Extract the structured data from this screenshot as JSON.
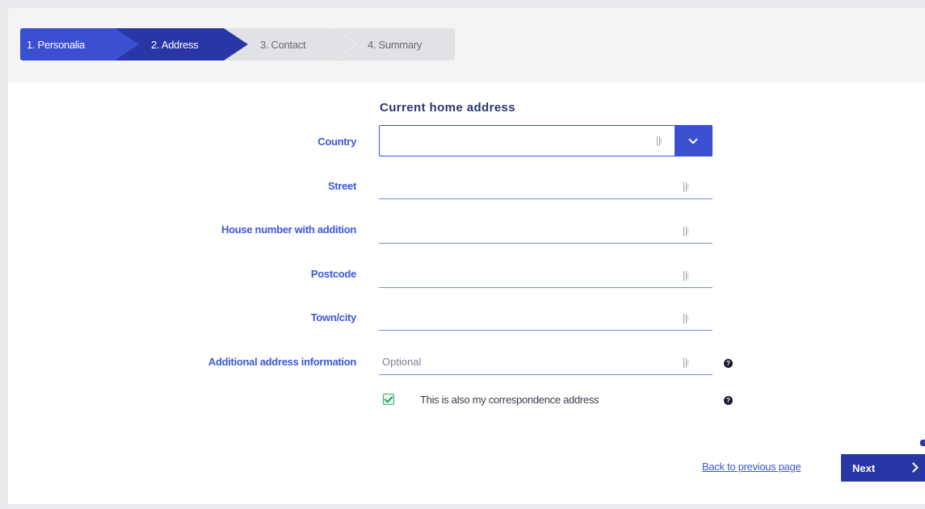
{
  "steps": [
    {
      "label": "1. Personalia",
      "state": "done"
    },
    {
      "label": "2. Address",
      "state": "active"
    },
    {
      "label": "3. Contact",
      "state": "pending"
    },
    {
      "label": "4. Summary",
      "state": "pending"
    }
  ],
  "form": {
    "title": "Current home address",
    "country": {
      "label": "Country",
      "value": ""
    },
    "street": {
      "label": "Street",
      "value": ""
    },
    "house_number": {
      "label": "House number with addition",
      "value": ""
    },
    "postcode": {
      "label": "Postcode",
      "value": ""
    },
    "town": {
      "label": "Town/city",
      "value": ""
    },
    "additional": {
      "label": "Additional address information",
      "placeholder": "Optional",
      "value": ""
    },
    "correspondence": {
      "label": "This is also my correspondence address",
      "checked": true
    }
  },
  "footer": {
    "back_label": "Back to previous page",
    "next_label": "Next"
  },
  "colors": {
    "primary": "#3b4fd1",
    "primary_dark": "#2a36a6",
    "label_blue": "#3d57d8",
    "success": "#38b36b"
  },
  "icons": {
    "field_cursor": "text-cursor-icon",
    "dropdown": "chevron-down-icon",
    "help": "question-circle-icon",
    "next": "chevron-right-icon",
    "checkbox": "checkmark-icon"
  }
}
